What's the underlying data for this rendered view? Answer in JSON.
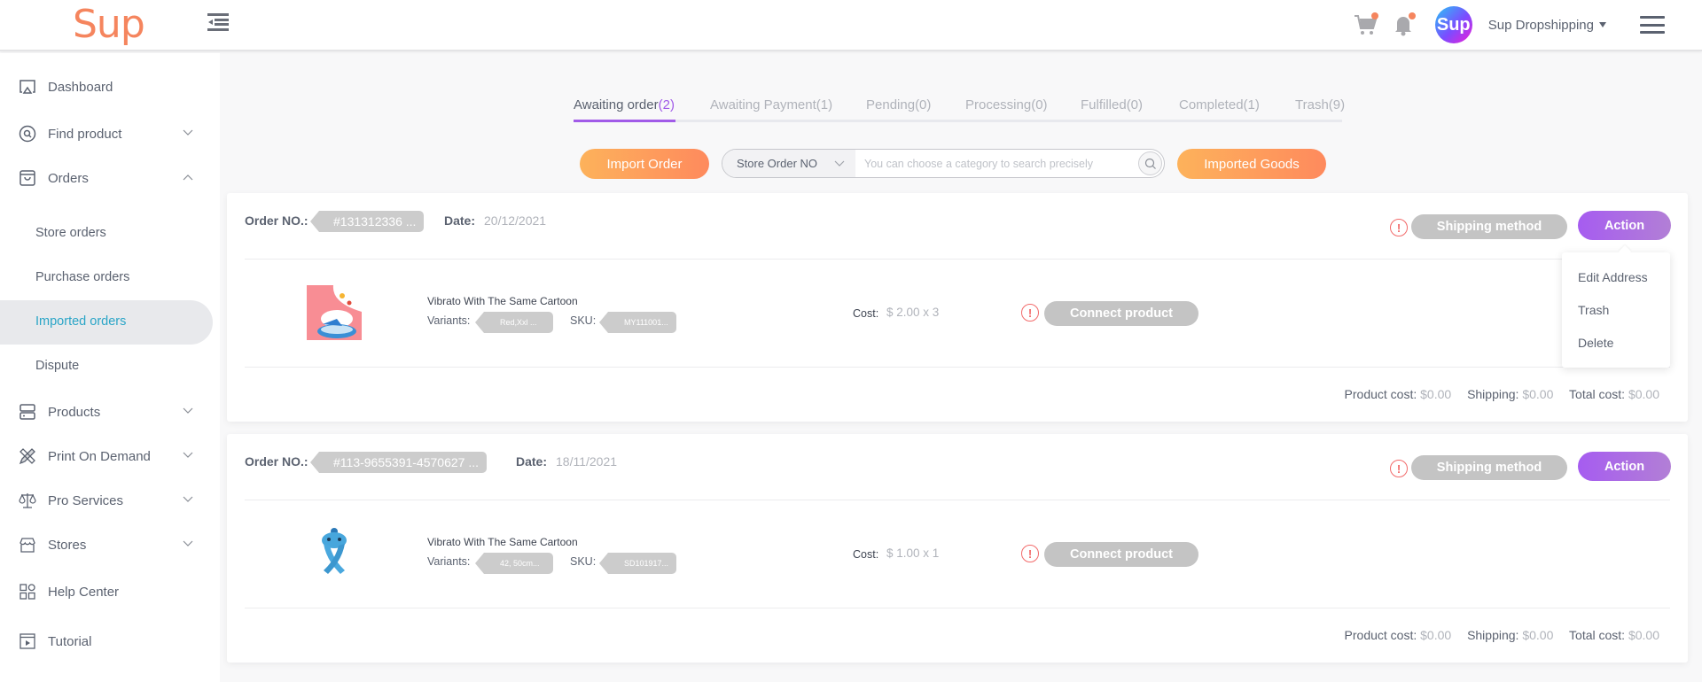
{
  "header": {
    "logo": "Sup",
    "avatar_text": "Sup",
    "user_name": "Sup Dropshipping",
    "icons": [
      "collapse-menu-icon",
      "cart-icon",
      "bell-icon",
      "hamburger-menu-icon"
    ],
    "accent_color": "#a15be8",
    "brand_color": "#f5855e"
  },
  "sidebar": {
    "items": [
      {
        "label": "Dashboard",
        "icon": "monitor-icon"
      },
      {
        "label": "Find product",
        "icon": "search-circle-icon",
        "expandable": true
      },
      {
        "label": "Orders",
        "icon": "bag-icon",
        "expanded": true
      },
      {
        "label": "Products",
        "icon": "server-icon",
        "expandable": true
      },
      {
        "label": "Print On Demand",
        "icon": "pencil-ruler-icon",
        "expandable": true
      },
      {
        "label": "Pro Services",
        "icon": "scale-icon",
        "expandable": true
      },
      {
        "label": "Stores",
        "icon": "store-icon",
        "expandable": true
      },
      {
        "label": "Help Center",
        "icon": "grid-icon"
      },
      {
        "label": "Tutorial",
        "icon": "video-icon"
      }
    ],
    "orders_sub": [
      {
        "label": "Store orders"
      },
      {
        "label": "Purchase orders"
      },
      {
        "label": "Imported orders",
        "active": true
      },
      {
        "label": "Dispute"
      }
    ]
  },
  "tabs": [
    {
      "name": "Awaiting order",
      "count": "(2)",
      "active": true
    },
    {
      "name": "Awaiting Payment",
      "count": "(1)"
    },
    {
      "name": "Pending",
      "count": "(0)"
    },
    {
      "name": "Processing",
      "count": "(0)"
    },
    {
      "name": "Fulfilled",
      "count": "(0)"
    },
    {
      "name": "Completed",
      "count": "(1)"
    },
    {
      "name": "Trash",
      "count": "(9)"
    }
  ],
  "toolbar": {
    "import_order": "Import Order",
    "search_category": "Store Order NO",
    "search_placeholder": "You can choose a category to search precisely",
    "search_value": "",
    "imported_goods": "Imported Goods"
  },
  "labels": {
    "order_no": "Order NO.:",
    "date": "Date:",
    "shipping_method": "Shipping method",
    "action": "Action",
    "variants": "Variants:",
    "sku": "SKU:",
    "cost": "Cost:",
    "connect_product": "Connect product",
    "product_cost": "Product cost:",
    "shipping": "Shipping:",
    "total_cost": "Total cost:"
  },
  "orders": [
    {
      "order_no": "#131312336 ...",
      "date": "20/12/2021",
      "product_name": "Vibrato With The Same Cartoon",
      "variants": "Red,Xxl ...",
      "sku": "MY111001...",
      "cost": "$ 2.00 x 3",
      "product_cost": "$0.00",
      "shipping": "$0.00",
      "total_cost": "$0.00"
    },
    {
      "order_no": "#113-9655391-4570627 ...",
      "date": "18/11/2021",
      "product_name": "Vibrato With The Same Cartoon",
      "variants": "42, 50cm...",
      "sku": "SD101917...",
      "cost": "$ 1.00 x 1",
      "product_cost": "$0.00",
      "shipping": "$0.00",
      "total_cost": "$0.00"
    }
  ],
  "action_menu": {
    "items": [
      "Edit Address",
      "Trash",
      "Delete"
    ]
  }
}
